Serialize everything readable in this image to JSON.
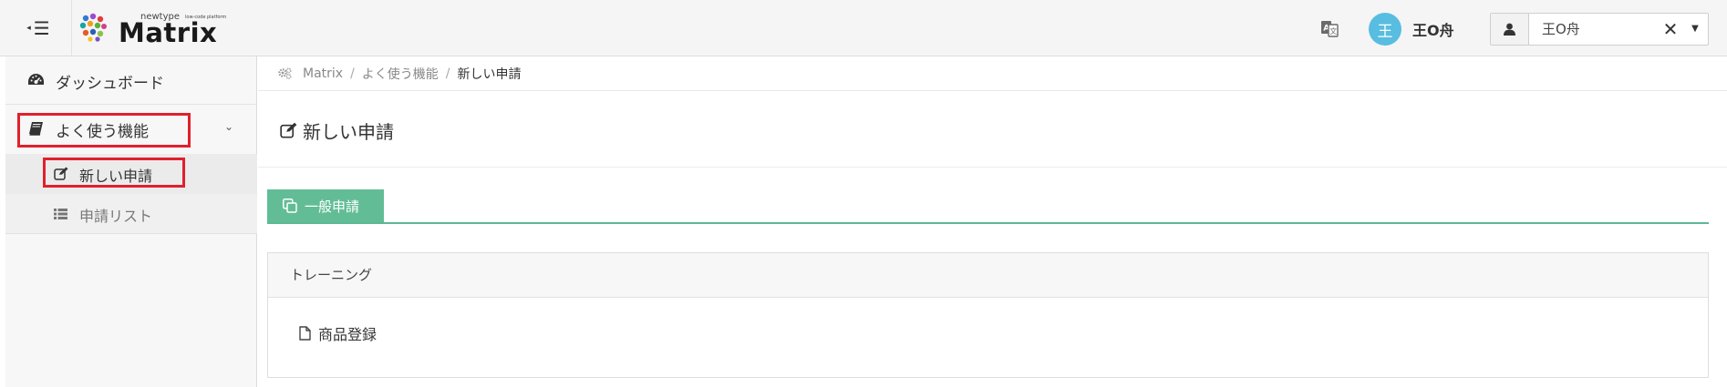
{
  "header": {
    "menu_toggle_icon": "menu-collapse-icon",
    "logo": {
      "small_top": "newtype",
      "small_tag": "low-code platform",
      "main": "Matrix"
    },
    "translate_icon": "translate-icon",
    "user": {
      "avatar_initial": "王",
      "name": "王O舟"
    },
    "user_select": {
      "value": "王O舟",
      "clear_glyph": "✕",
      "arrow_glyph": "▼"
    }
  },
  "sidebar": {
    "items": [
      {
        "label": "ダッシュボード",
        "icon": "dashboard-icon"
      },
      {
        "label": "よく使う機能",
        "icon": "book-icon",
        "expanded": true
      },
      {
        "label": "新しい申請",
        "icon": "edit-icon",
        "active": true
      },
      {
        "label": "申請リスト",
        "icon": "list-icon"
      }
    ],
    "highlight_color": "#e0202d"
  },
  "breadcrumb": {
    "items": [
      "Matrix",
      "よく使う機能",
      "新しい申請"
    ],
    "separator": "/"
  },
  "page": {
    "title": "新しい申請",
    "tabs": [
      {
        "label": "一般申請",
        "active": true
      }
    ],
    "accent_color": "#62bd96",
    "panel": {
      "heading": "トレーニング",
      "links": [
        {
          "label": "商品登録",
          "icon": "file-icon"
        }
      ]
    }
  }
}
